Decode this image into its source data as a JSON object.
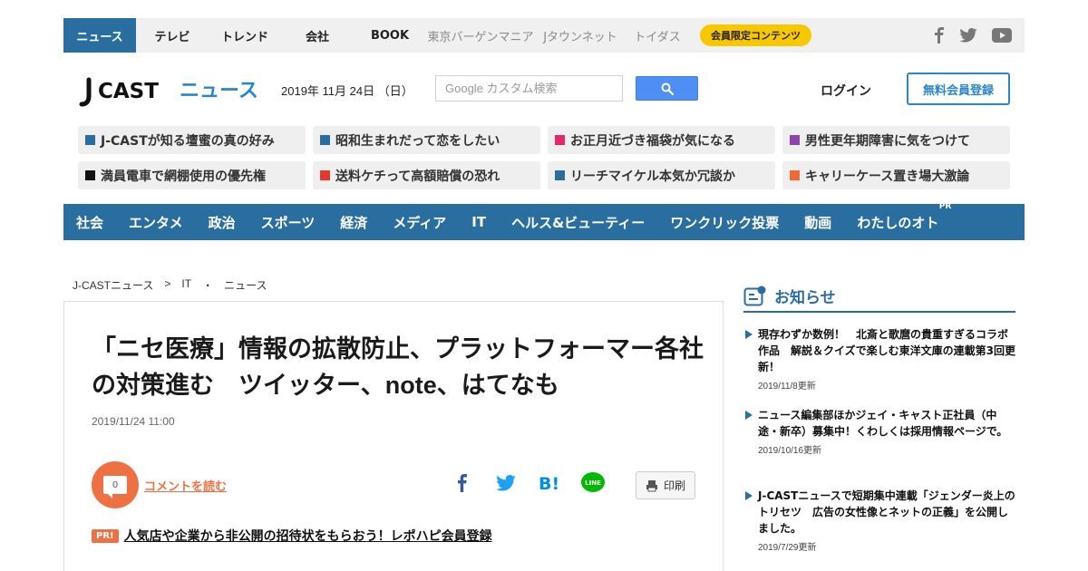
{
  "top_nav": {
    "items": [
      "ニュース",
      "テレビ",
      "トレンド",
      "会社",
      "BOOK"
    ],
    "gray_items": [
      "東京バーゲンマニア",
      "Jタウンネット",
      "トイダス"
    ],
    "member_pill": "会員限定コンテンツ",
    "social": [
      "facebook-icon",
      "twitter-icon",
      "youtube-icon"
    ]
  },
  "header": {
    "logo_text": "J-CAST ニュース",
    "date": "2019年 11月 24日 （日）",
    "search_placeholder": "Google カスタム検索",
    "login": "ログイン",
    "register": "無料会員登録"
  },
  "trends": [
    {
      "label": "J-CASTが知る壇蜜の真の好み",
      "color": "#2a6ea0"
    },
    {
      "label": "昭和生まれだって恋をしたい",
      "color": "#2a6ea0"
    },
    {
      "label": "お正月近づき福袋が気になる",
      "color": "#e8266a"
    },
    {
      "label": "男性更年期障害に気をつけて",
      "color": "#8e44ad"
    },
    {
      "label": "満員電車で網棚使用の優先権",
      "color": "#111111"
    },
    {
      "label": "送料ケチって高額賠償の恐れ",
      "color": "#e03a2a"
    },
    {
      "label": "リーチマイケル本気か冗談か",
      "color": "#2a6ea0"
    },
    {
      "label": "キャリーケース置き場大激論",
      "color": "#f06a35"
    }
  ],
  "categories": [
    "社会",
    "エンタメ",
    "政治",
    "スポーツ",
    "経済",
    "メディア",
    "IT",
    "ヘルス&ビューティー",
    "ワンクリック投票",
    "動画",
    "わたしのオト"
  ],
  "category_pr": "PR",
  "breadcrumb": [
    "J-CASTニュース",
    ">",
    "IT",
    "・",
    "ニュース"
  ],
  "article": {
    "title": "「ニセ医療」情報の拡散防止、プラットフォーマー各社の対策進む　ツイッター、note、はてなも",
    "date": "2019/11/24 11:00",
    "comment_count": "0",
    "comment_link": "コメントを読む",
    "print": "印刷",
    "pr_badge": "PR!",
    "pr_link": "人気店や企業から非公開の招待状をもらおう！レポハピ会員登録"
  },
  "sidebar": {
    "title": "お知らせ",
    "notices": [
      {
        "text": "現存わずか数例！　北斎と歌麿の貴重すぎるコラボ作品　解説＆クイズで楽しむ東洋文庫の連載第3回更新！",
        "date": "2019/11/8更新"
      },
      {
        "text": "ニュース編集部ほかジェイ・キャスト正社員（中途・新卒）募集中！くわしくは採用情報ページで。",
        "date": "2019/10/16更新"
      },
      {
        "text": "J-CASTニュースで短期集中連載「ジェンダー炎上のトリセツ　広告の女性像とネットの正義」を公開しました。",
        "date": "2019/7/29更新"
      }
    ]
  }
}
